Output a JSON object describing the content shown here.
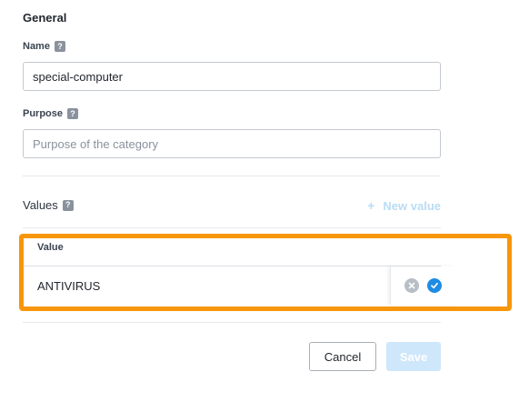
{
  "general": {
    "title": "General",
    "name_label": "Name",
    "name_value": "special-computer",
    "purpose_label": "Purpose",
    "purpose_placeholder": "Purpose of the category",
    "help_glyph": "?"
  },
  "values": {
    "label": "Values",
    "new_value_plus": "+",
    "new_value_label": "New value",
    "column_header": "Value",
    "rows": [
      {
        "value": "ANTIVIRUS"
      }
    ]
  },
  "footer": {
    "cancel_label": "Cancel",
    "save_label": "Save"
  },
  "colors": {
    "highlight": "#f7960b",
    "primary": "#1f8ce3",
    "primary_disabled": "#cfe7fb"
  }
}
